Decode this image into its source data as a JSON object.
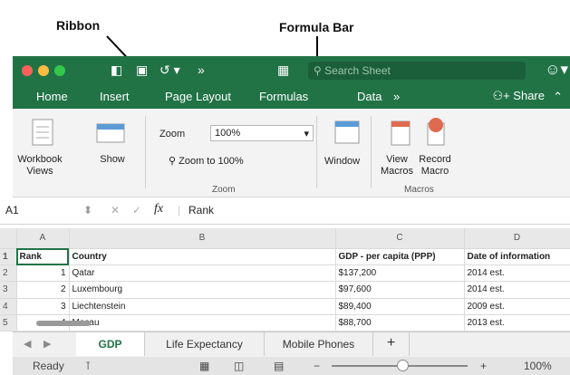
{
  "annotations": {
    "ribbon": "Ribbon",
    "formula_bar": "Formula Bar"
  },
  "title_bar": {
    "buttons": [
      "sidebar-toggle-icon",
      "save-icon",
      "undo-icon",
      "more-icon"
    ],
    "search_placeholder": "Search Sheet",
    "traffic_lights": [
      "#fc605c",
      "#fdbc40",
      "#34c84a"
    ],
    "accent": "#217346"
  },
  "ribbon_tabs": {
    "home": "Home",
    "insert": "Insert",
    "page_layout": "Page Layout",
    "formulas": "Formulas",
    "data": "Data",
    "more": "»",
    "share": "Share"
  },
  "ribbon": {
    "workbook_views": "Workbook Views",
    "show": "Show",
    "zoom_label": "Zoom",
    "zoom_value": "100%",
    "zoom_to_100": "Zoom to 100%",
    "zoom_group": "Zoom",
    "window": "Window",
    "view_macros": "View Macros",
    "record_macro": "Record Macro",
    "macros_group": "Macros"
  },
  "formula_bar": {
    "name_box": "A1",
    "fx": "fx",
    "content": "Rank"
  },
  "grid": {
    "columns": [
      "A",
      "B",
      "C",
      "D"
    ],
    "rows": [
      {
        "n": "1",
        "a": "Rank",
        "b": "Country",
        "c": "GDP - per capita (PPP)",
        "d": "Date of information"
      },
      {
        "n": "2",
        "a": "1",
        "b": "Qatar",
        "c": "$137,200",
        "d": "2014 est."
      },
      {
        "n": "3",
        "a": "2",
        "b": "Luxembourg",
        "c": "$97,600",
        "d": "2014 est."
      },
      {
        "n": "4",
        "a": "3",
        "b": "Liechtenstein",
        "c": "$89,400",
        "d": "2009 est."
      },
      {
        "n": "5",
        "a": "4",
        "b": "Macau",
        "c": "$88,700",
        "d": "2013 est."
      }
    ]
  },
  "sheets": [
    "GDP",
    "Life Expectancy",
    "Mobile Phones"
  ],
  "add_sheet": "+",
  "status": {
    "ready": "Ready",
    "zoom": "100%",
    "minus": "−",
    "plus": "+"
  }
}
